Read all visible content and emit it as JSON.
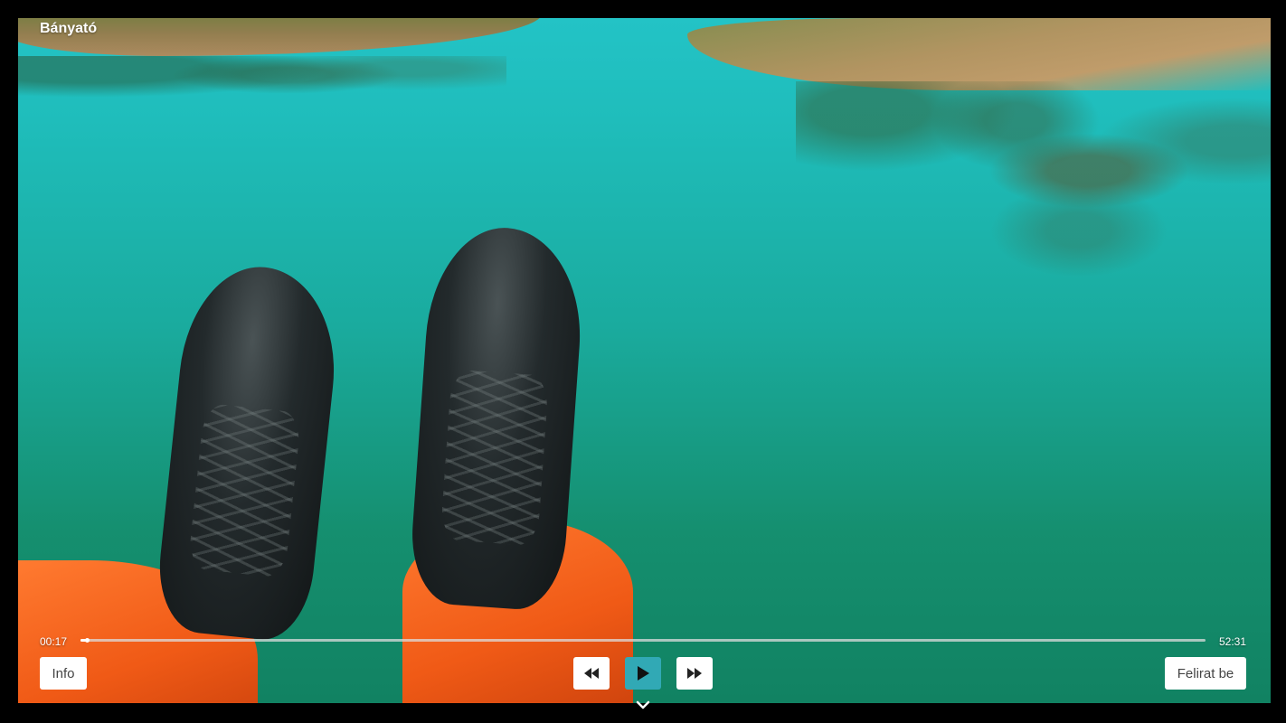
{
  "video": {
    "title": "Bányató",
    "current_time": "00:17",
    "total_time": "52:31",
    "progress": 0.0054
  },
  "controls": {
    "info_label": "Info",
    "subtitles_label": "Felirat be",
    "rewind_icon": "rewind-icon",
    "play_icon": "play-icon",
    "forward_icon": "fast-forward-icon",
    "expand_icon": "chevron-down-icon"
  },
  "colors": {
    "accent": "#31a9b5",
    "button_bg": "#ffffff",
    "text": "#ffffff"
  }
}
